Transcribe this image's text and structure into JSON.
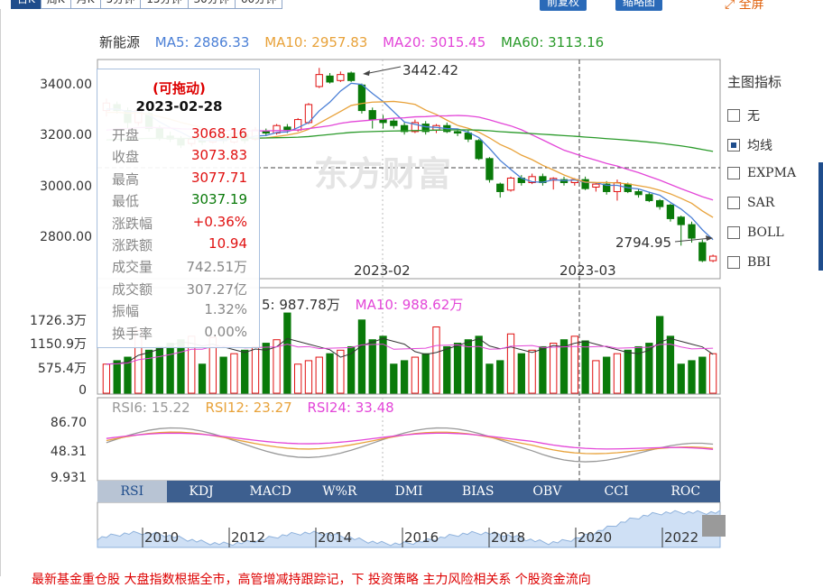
{
  "tabs": [
    "日K",
    "周K",
    "月K",
    "5分钟",
    "15分钟",
    "30分钟",
    "60分钟"
  ],
  "buttons": {
    "fq": "前复权",
    "zoom": "缩略图",
    "fullscreen": "全屏"
  },
  "legend": {
    "name": "新能源",
    "ma5": "MA5: 2886.33",
    "ma10": "MA10: 2957.83",
    "ma20": "MA20: 3015.45",
    "ma60": "MA60: 3113.16"
  },
  "colors": {
    "ma5": "#4a7fd6",
    "ma10": "#e8a23a",
    "ma20": "#e346d8",
    "ma60": "#2a9a2a",
    "up": "#e01010",
    "down": "#0a7a0a"
  },
  "price_axis": [
    "3400.00",
    "3200.00",
    "3000.00",
    "2800.00"
  ],
  "date_axis": [
    "2023-02",
    "2023-03"
  ],
  "annotations": {
    "high": "3442.42",
    "low": "2794.95"
  },
  "tooltip": {
    "title": "(可拖动)",
    "date": "2023-02-28",
    "rows": [
      {
        "k": "开盘",
        "v": "3068.16",
        "c": "#e01010"
      },
      {
        "k": "收盘",
        "v": "3073.83",
        "c": "#e01010"
      },
      {
        "k": "最高",
        "v": "3077.71",
        "c": "#e01010"
      },
      {
        "k": "最低",
        "v": "3037.19",
        "c": "#0a7a0a"
      },
      {
        "k": "涨跌幅",
        "v": "+0.36%",
        "c": "#e01010"
      },
      {
        "k": "涨跌额",
        "v": "10.94",
        "c": "#e01010"
      },
      {
        "k": "成交量",
        "v": "742.51万",
        "c": "#888"
      },
      {
        "k": "成交额",
        "v": "307.27亿",
        "c": "#888"
      },
      {
        "k": "振幅",
        "v": "1.32%",
        "c": "#888"
      },
      {
        "k": "换手率",
        "v": "0.00%",
        "c": "#888"
      }
    ]
  },
  "side": {
    "title": "主图指标",
    "items": [
      {
        "label": "无",
        "on": false
      },
      {
        "label": "均线",
        "on": true
      },
      {
        "label": "EXPMA",
        "on": false
      },
      {
        "label": "SAR",
        "on": false
      },
      {
        "label": "BOLL",
        "on": false
      },
      {
        "label": "BBI",
        "on": false
      }
    ]
  },
  "volume": {
    "ma5": "5: 987.78万",
    "ma10": "MA10: 988.62万",
    "axis": [
      "1726.3万",
      "1150.9万",
      "575.4万",
      "0"
    ]
  },
  "rsi": {
    "rsi6": "RSI6: 15.22",
    "rsi12": "RSI12: 23.27",
    "rsi24": "RSI24: 33.48",
    "axis": [
      "86.70",
      "48.31",
      "9.931"
    ]
  },
  "indicators": [
    "RSI",
    "KDJ",
    "MACD",
    "W%R",
    "DMI",
    "BIAS",
    "OBV",
    "CCI",
    "ROC"
  ],
  "navigator_years": [
    "2010",
    "2012",
    "2014",
    "2016",
    "2018",
    "2020",
    "2022"
  ],
  "bottom_text": "最新基金重仓股  大盘指数根据全市，高管增减持跟踪记，下    投资策略  主力风险相关系  个股资金流向",
  "chart_data": {
    "type": "candlestick",
    "title": "新能源",
    "xlabel": "",
    "ylabel": "",
    "ylim": [
      2740,
      3470
    ],
    "x_ticks": [
      "2023-02",
      "2023-03"
    ],
    "candles": [
      [
        3300,
        3325,
        3280,
        3340
      ],
      [
        3320,
        3300,
        3290,
        3330
      ],
      [
        3300,
        3260,
        3240,
        3310
      ],
      [
        3260,
        3300,
        3250,
        3310
      ],
      [
        3290,
        3240,
        3230,
        3300
      ],
      [
        3240,
        3210,
        3200,
        3250
      ],
      [
        3215,
        3205,
        3195,
        3230
      ],
      [
        3205,
        3185,
        3175,
        3215
      ],
      [
        3190,
        3205,
        3180,
        3215
      ],
      [
        3200,
        3195,
        3185,
        3210
      ],
      [
        3195,
        3215,
        3190,
        3220
      ],
      [
        3210,
        3200,
        3190,
        3225
      ],
      [
        3195,
        3225,
        3190,
        3230
      ],
      [
        3220,
        3200,
        3190,
        3230
      ],
      [
        3205,
        3235,
        3200,
        3245
      ],
      [
        3230,
        3225,
        3215,
        3240
      ],
      [
        3225,
        3250,
        3220,
        3255
      ],
      [
        3245,
        3235,
        3225,
        3255
      ],
      [
        3235,
        3270,
        3230,
        3275
      ],
      [
        3260,
        3320,
        3255,
        3325
      ],
      [
        3380,
        3420,
        3375,
        3442
      ],
      [
        3415,
        3395,
        3390,
        3425
      ],
      [
        3400,
        3420,
        3395,
        3430
      ],
      [
        3425,
        3400,
        3395,
        3430
      ],
      [
        3385,
        3300,
        3290,
        3390
      ],
      [
        3300,
        3270,
        3240,
        3310
      ],
      [
        3270,
        3260,
        3240,
        3285
      ],
      [
        3265,
        3250,
        3240,
        3275
      ],
      [
        3250,
        3230,
        3220,
        3260
      ],
      [
        3230,
        3260,
        3225,
        3270
      ],
      [
        3255,
        3230,
        3220,
        3265
      ],
      [
        3235,
        3250,
        3225,
        3255
      ],
      [
        3250,
        3230,
        3225,
        3260
      ],
      [
        3230,
        3225,
        3215,
        3240
      ],
      [
        3225,
        3205,
        3195,
        3235
      ],
      [
        3200,
        3140,
        3135,
        3205
      ],
      [
        3140,
        3070,
        3060,
        3145
      ],
      [
        3055,
        3030,
        3010,
        3060
      ],
      [
        3035,
        3075,
        3030,
        3080
      ],
      [
        3075,
        3060,
        3050,
        3085
      ],
      [
        3060,
        3080,
        3055,
        3090
      ],
      [
        3080,
        3060,
        3050,
        3090
      ],
      [
        3068,
        3074,
        3037,
        3078
      ],
      [
        3070,
        3060,
        3050,
        3080
      ],
      [
        3060,
        3070,
        3050,
        3075
      ],
      [
        3070,
        3040,
        3035,
        3080
      ],
      [
        3045,
        3055,
        3030,
        3060
      ],
      [
        3055,
        3030,
        3020,
        3065
      ],
      [
        3030,
        3060,
        3000,
        3070
      ],
      [
        3055,
        3030,
        3025,
        3060
      ],
      [
        3030,
        3020,
        3010,
        3040
      ],
      [
        3020,
        3000,
        2995,
        3030
      ],
      [
        3000,
        2980,
        2970,
        3005
      ],
      [
        2985,
        2940,
        2930,
        2990
      ],
      [
        2945,
        2920,
        2850,
        2950
      ],
      [
        2920,
        2875,
        2860,
        2930
      ],
      [
        2860,
        2800,
        2795,
        2870
      ],
      [
        2800,
        2815,
        2795,
        2820
      ]
    ]
  }
}
